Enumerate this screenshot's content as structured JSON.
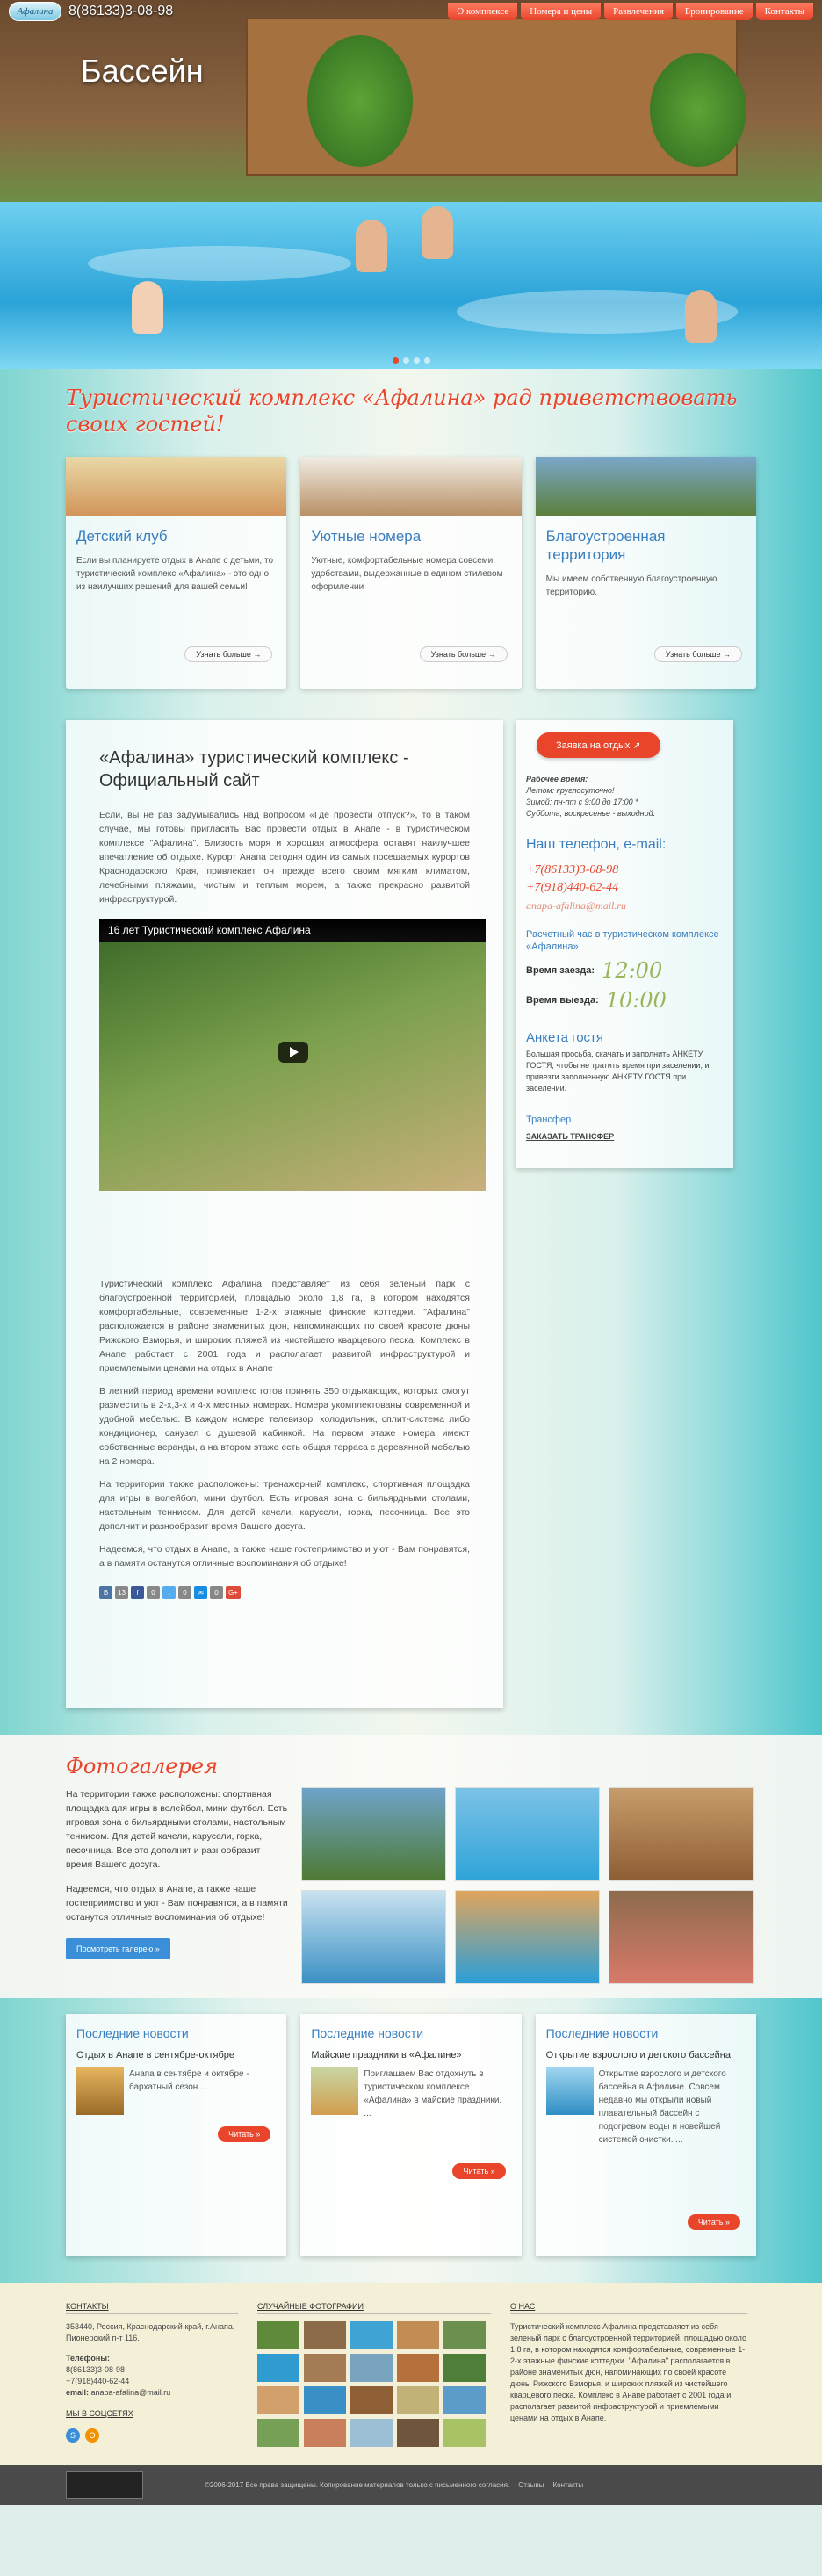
{
  "header": {
    "logo": "Афалина",
    "phone": "8(86133)3-08-98",
    "nav": [
      "О комплексе",
      "Номера и цены",
      "Развлечения",
      "Бронирование",
      "Контакты"
    ]
  },
  "hero": {
    "title": "Бассейн"
  },
  "welcome": "Туристический комплекс «Афалина» рад приветствовать своих гостей!",
  "cards": [
    {
      "title": "Детский клуб",
      "text": "Если вы планируете отдых в Анапе с детьми, то туристический комплекс «Афалина» - это одно из наилучших решений для вашей семьи!",
      "button": "Узнать больше →"
    },
    {
      "title": "Уютные номера",
      "text": "Уютные, комфортабельные номера совсеми удобствами, выдержанные в едином стилевом оформлении",
      "button": "Узнать больше →"
    },
    {
      "title": "Благоустроенная территория",
      "text": "Мы имеем собственную благоустроенную территорию.",
      "button": "Узнать больше →"
    }
  ],
  "article": {
    "title": "«Афалина» туристический комплекс - Официальный сайт",
    "intro": "Если, вы не раз задумывались над вопросом «Где провести отпуск?», то в таком случае, мы готовы пригласить Вас провести отдых в Анапе - в туристическом комплексе \"Афалина\". Близость моря и хорошая атмосфера оставят наилучшее впечатление об отдыхе. Курорт Анапа сегодня один из самых посещаемых курортов Краснодарского Края, привлекает он прежде всего своим мягким климатом, лечебными пляжами, чистым и теплым морем, а также прекрасно развитой инфраструктурой.",
    "video_title": "16 лет Туристический комплекс Афалина",
    "p1": "Туристический комплекс Афалина представляет из себя зеленый парк с благоустроенной территорией, площадью около 1,8 га, в котором находятся комфортабельные, современные 1-2-х этажные финские коттеджи. \"Афалина\" расположается в районе знаменитых дюн, напоминающих по своей красоте дюны Рижского Взморья, и широких пляжей из чистейшего кварцевого песка. Комплекс в Анапе работает с 2001 года и располагает развитой инфраструктурой и приемлемыми ценами на отдых в Анапе",
    "p2": "В летний период времени комплекс готов принять 350 отдыхающих, которых смогут разместить в 2-х,3-х и 4-х местных номерах. Номера укомплектованы современной и удобной мебелью. В каждом номере телевизор, холодильник, сплит-система либо кондиционер, санузел с душевой кабинкой. На первом этаже номера имеют собственные веранды, а на втором этаже есть общая терраса с деревянной мебелью на 2 номера.",
    "p3": "На территории также расположены: тренажерный комплекс, спортивная площадка для игры в волейбол, мини футбол. Есть игровая зона с бильярдными столами, настольным теннисом. Для детей качели, карусели, горка, песочница. Все это дополнит и разнообразит время Вашего досуга.",
    "p4": "Надеемся, что отдых в Анапе, а также наше гостеприимство и уют - Вам понравятся, а в памяти останутся отличные воспоминания об отдыхе!",
    "share": [
      "В",
      "13",
      "f",
      "0",
      "t",
      "0",
      "✉",
      "0",
      "G+"
    ]
  },
  "sidebar": {
    "order_button": "Заявка на отдых ➚",
    "work_title": "Рабочее время:",
    "summer": "Летом: круглосуточно!",
    "winter": "Зимой: пн-пт с 9:00 до 17:00 *",
    "weekend": "Суббота, воскресенье - выходной.",
    "contact_title": "Наш телефон, e-mail:",
    "phone1": "+7(86133)3-08-98",
    "phone2": "+7(918)440-62-44",
    "email": "anapa-afalina@mail.ru",
    "checkin_title": "Расчетный час в туристическом комплексе «Афалина»",
    "checkin_label": "Время заезда:",
    "checkin_time": "12:00",
    "checkout_label": "Время выезда:",
    "checkout_time": "10:00",
    "survey_title": "Анкета гостя",
    "survey_text": "Большая просьба, скачать и заполнить АНКЕТУ ГОСТЯ, чтобы не тратить время при заселении, и привезти заполненную АНКЕТУ ГОСТЯ при заселении.",
    "transfer_title": "Трансфер",
    "transfer_link": "ЗАКАЗАТЬ ТРАНСФЕР"
  },
  "gallery": {
    "title": "Фотогалерея",
    "p1": "На территории также расположены: спортивная площадка для игры в волейбол, мини футбол. Есть игровая зона с бильярдными столами, настольным теннисом. Для детей качели, карусели, горка, песочница. Все это дополнит и разнообразит время Вашего досуга.",
    "p2": "Надеемся, что отдых в Анапе, а также наше гостеприимство и уют - Вам понравятся, а в памяти останутся отличные воспоминания об отдыхе!",
    "button": "Посмотреть галерею »"
  },
  "news": [
    {
      "heading": "Последние новости",
      "title": "Отдых в Анапе в сентябре-октябре",
      "text": "Анапа в сентябре и октябре - бархатный сезон ...",
      "button": "Читать »"
    },
    {
      "heading": "Последние новости",
      "title": "Майские праздники в «Афалине»",
      "text": "Приглашаем Вас отдохнуть в туристическом комплексе «Афалина» в майские праздники. ...",
      "button": "Читать »"
    },
    {
      "heading": "Последние новости",
      "title": "Открытие взрослого и детского бассейна.",
      "text": "Открытие взрослого и детского бассейна в Афалине. Совсем недавно мы открыли новый плавательный бассейн с подогревом воды и новейшей системой очистки. ...",
      "button": "Читать »"
    }
  ],
  "footer": {
    "contacts_title": "КОНТАКТЫ",
    "address": "353440, Россия, Краснодарский край, г.Анапа, Пионерский п-т 116.",
    "phones_label": "Телефоны:",
    "phone1": "8(86133)3-08-98",
    "phone2": "+7(918)440-62-44",
    "email_label": "email:",
    "email": "anapa-afalina@mail.ru",
    "social_title": "МЫ В СОЦСЕТЯХ",
    "photos_title": "СЛУЧАЙНЫЕ ФОТОГРАФИИ",
    "about_title": "О НАС",
    "about_text": "Туристический комплекс Афалина представляет из себя зеленый парк с благоустроенной территорией, площадью около 1.8 га, в котором находятся комфортабельные, современные 1-2-х этажные финские коттеджи. \"Афалина\" располагается в районе знаменитых дюн, напоминающих по своей красоте дюны Рижского Взморья, и широких пляжей из чистейшего кварцевого песка. Комплекс в Анапе работает с 2001 года и располагает развитой инфраструктурой и приемлемыми ценами на отдых в Анапе."
  },
  "bottom": {
    "copyright": "©2006-2017 Все права защищены. Копирование материалов только с письменного согласия.",
    "link1": "Отзывы",
    "link2": "Контакты"
  }
}
